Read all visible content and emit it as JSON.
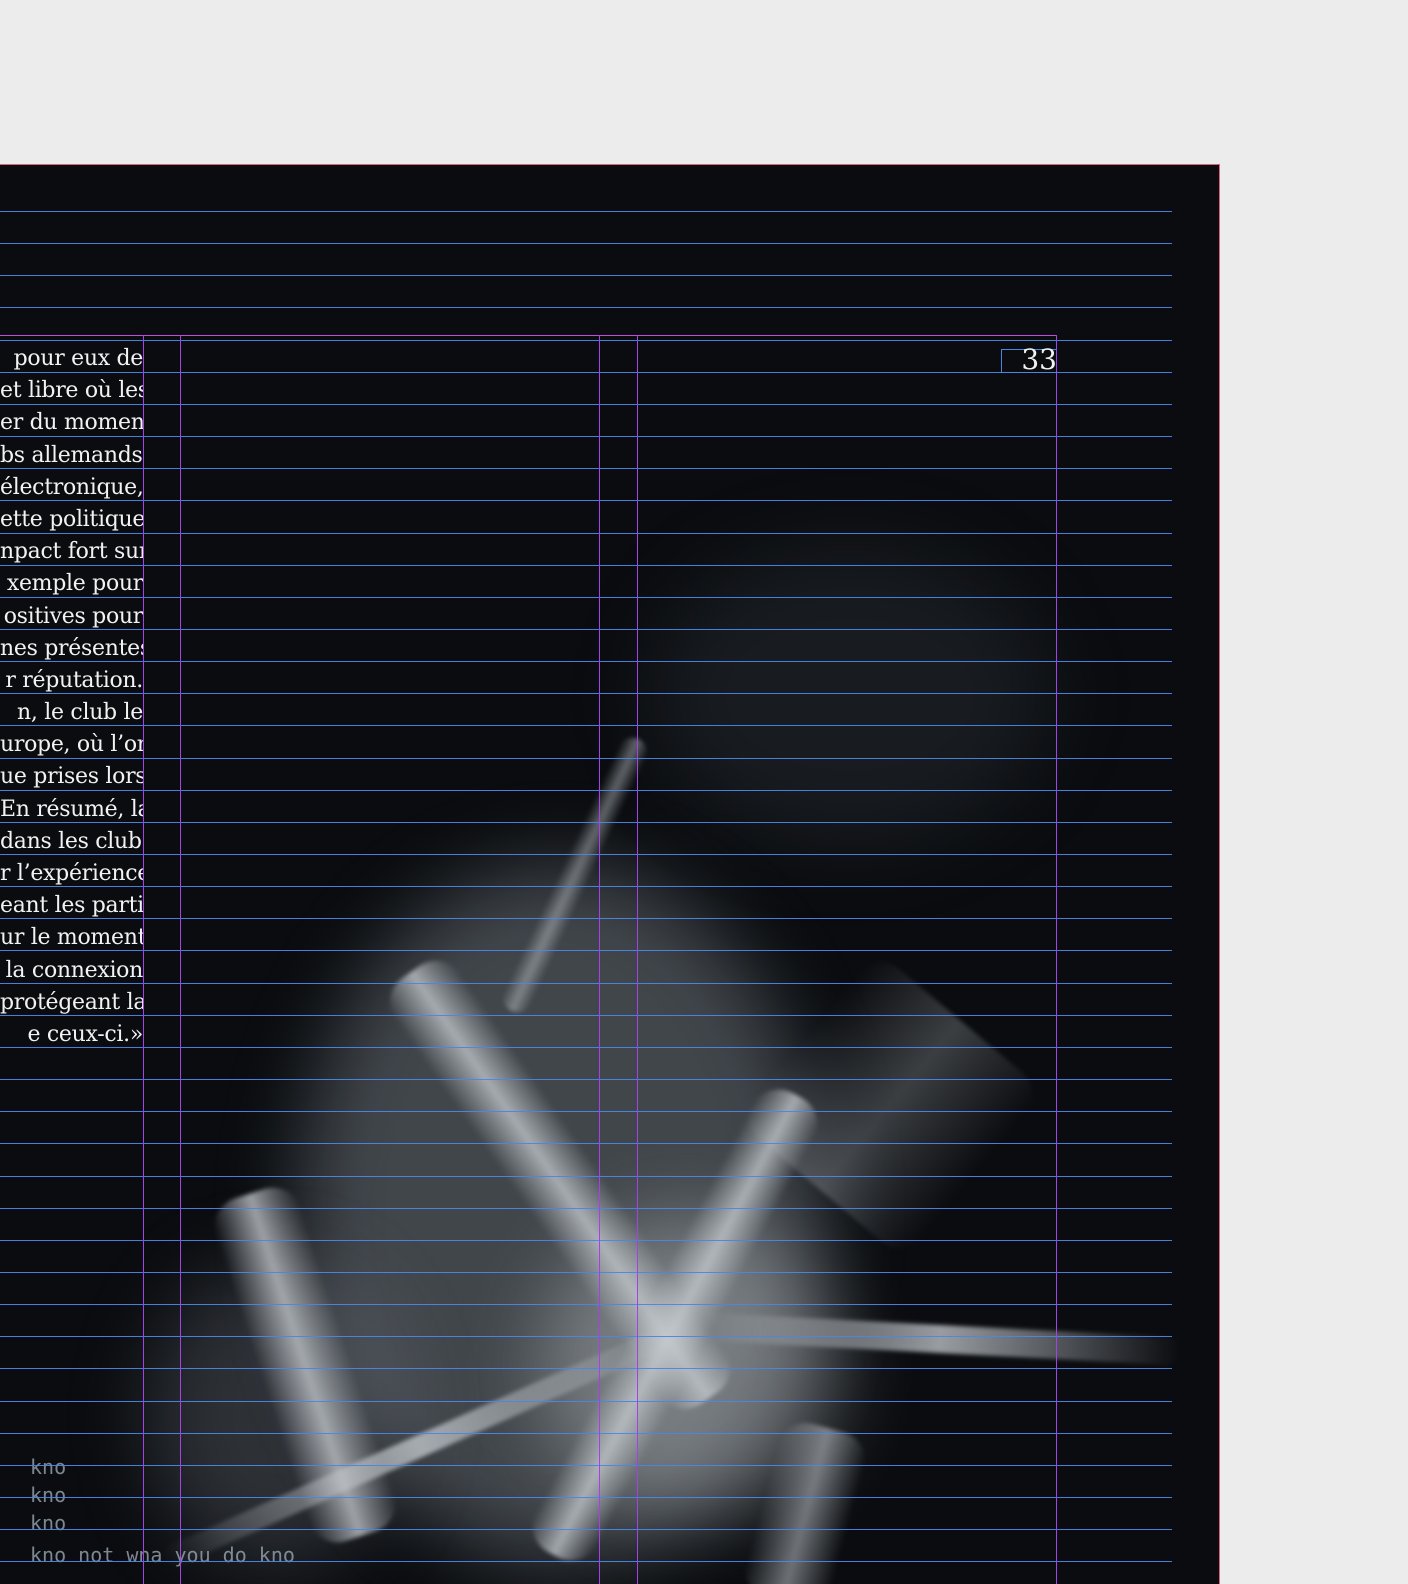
{
  "page": {
    "number": "33",
    "background_color": "#0a0c0f",
    "bleed_color": "#e0607a",
    "baseline_grid_color": "#4a86e8",
    "column_guide_color": "#a143e8",
    "margin_guide_color": "#c44cdb"
  },
  "body_text": {
    "lines": [
      "pour eux de",
      "et libre où les",
      "er du moment",
      "bs allemands,",
      "électronique,",
      "ette politique.",
      "npact fort sur",
      "xemple pour",
      "ositives pour",
      "nes présentes,",
      "r réputation.",
      "n, le club le",
      "urope, où l’on",
      "ue prises lors",
      "En résumé, la",
      "dans les clubs",
      "r l’expérience",
      "eant les parti-",
      "ur le moment",
      "la connexion",
      "protégeant la",
      "e ceux-ci.»"
    ]
  },
  "photo": {
    "description_icon": "photo-image",
    "typewriter_fragments": [
      "kno",
      "kno",
      "kno",
      "kno  not wna you do kno"
    ]
  }
}
